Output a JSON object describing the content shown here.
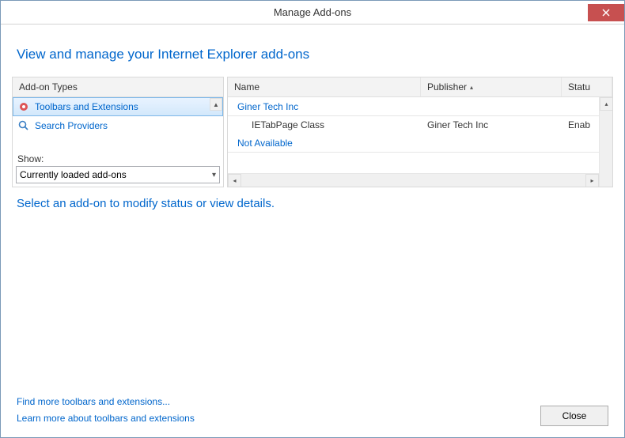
{
  "titlebar": {
    "title": "Manage Add-ons"
  },
  "heading": "View and manage your Internet Explorer add-ons",
  "leftPanel": {
    "header": "Add-on Types",
    "items": [
      {
        "label": "Toolbars and Extensions"
      },
      {
        "label": "Search Providers"
      }
    ],
    "showLabel": "Show:",
    "showValue": "Currently loaded add-ons"
  },
  "rightPanel": {
    "columns": {
      "name": "Name",
      "publisher": "Publisher",
      "status": "Statu"
    },
    "groups": [
      {
        "label": "Giner Tech Inc",
        "rows": [
          {
            "name": "IETabPage Class",
            "publisher": "Giner Tech Inc",
            "status": "Enab"
          }
        ]
      },
      {
        "label": "Not Available",
        "rows": []
      }
    ]
  },
  "detail": "Select an add-on to modify status or view details.",
  "footer": {
    "link1": "Find more toolbars and extensions...",
    "link2": "Learn more about toolbars and extensions",
    "close": "Close"
  }
}
